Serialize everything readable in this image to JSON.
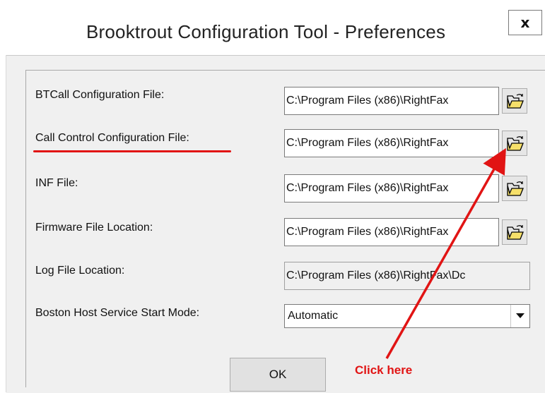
{
  "window": {
    "title": "Brooktrout Configuration Tool - Preferences",
    "close_label": "x"
  },
  "fields": [
    {
      "label": "BTCall Configuration File:",
      "value": "C:\\Program Files (x86)\\RightFax",
      "browse_icon": "folder-open-icon"
    },
    {
      "label": "Call Control Configuration File:",
      "value": "C:\\Program Files (x86)\\RightFax",
      "browse_icon": "folder-open-icon"
    },
    {
      "label": "INF File:",
      "value": "C:\\Program Files (x86)\\RightFax",
      "browse_icon": "folder-open-icon"
    },
    {
      "label": "Firmware File Location:",
      "value": "C:\\Program Files (x86)\\RightFax",
      "browse_icon": "folder-open-icon"
    },
    {
      "label": "Log File Location:",
      "value": "C:\\Program Files (x86)\\RightFax\\Dc"
    }
  ],
  "start_mode": {
    "label": "Boston Host Service Start Mode:",
    "value": "Automatic"
  },
  "buttons": {
    "ok_label": "OK"
  },
  "annotation": {
    "text": "Click here",
    "color": "#e11414"
  }
}
